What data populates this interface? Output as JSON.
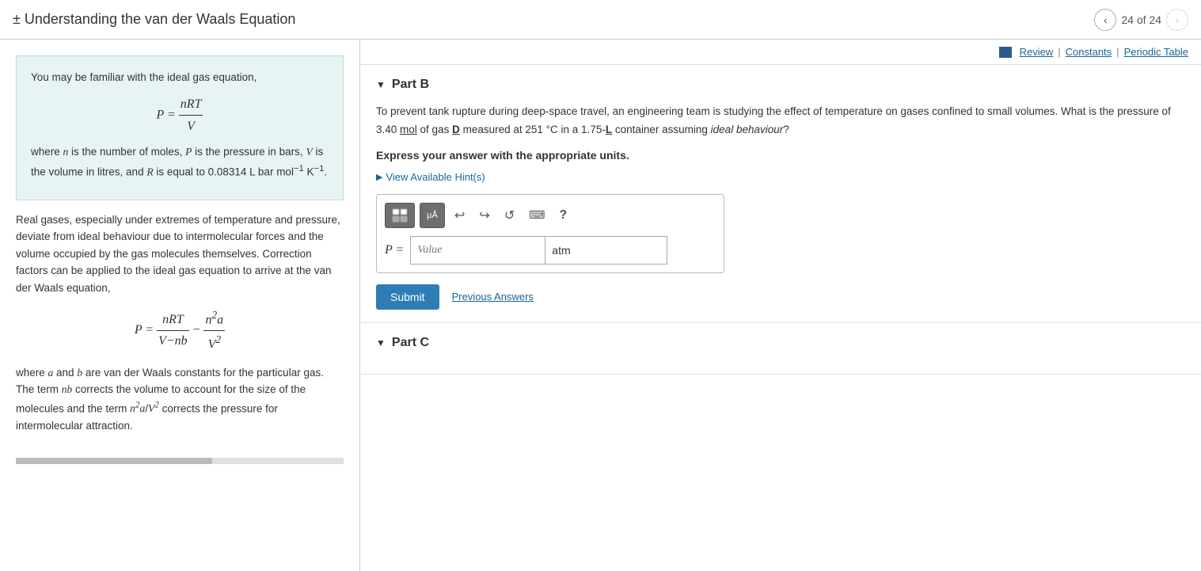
{
  "header": {
    "title": "± Understanding the van der Waals Equation",
    "pagination": "24 of 24",
    "prev_btn": "‹",
    "next_btn": "›"
  },
  "topbar": {
    "review_label": "Review",
    "constants_label": "Constants",
    "periodic_table_label": "Periodic Table",
    "sep": "|"
  },
  "left_panel": {
    "intro": "You may be familiar with the ideal gas equation,",
    "formula1_display": "P = nRT/V",
    "description1": "where n is the number of moles, P is the pressure in bars, V is the volume in litres, and R is equal to 0.08314 L bar mol⁻¹ K⁻¹.",
    "description2": "Real gases, especially under extremes of temperature and pressure, deviate from ideal behaviour due to intermolecular forces and the volume occupied by the gas molecules themselves. Correction factors can be applied to the ideal gas equation to arrive at the van der Waals equation,",
    "formula2_display": "P = nRT/(V−nb) − n²a/V²",
    "description3": "where a and b are van der Waals constants for the particular gas. The term nb corrects the volume to account for the size of the molecules and the term n²a/V² corrects the pressure for intermolecular attraction."
  },
  "part_b": {
    "label": "Part B",
    "question": "To prevent tank rupture during deep-space travel, an engineering team is studying the effect of temperature on gases confined to small volumes. What is the pressure of 3.40 mol of gas D measured at 251 °C in a 1.75-L container assuming ideal behaviour?",
    "bold_note": "Express your answer with the appropriate units.",
    "hint_label": "View Available Hint(s)",
    "value_placeholder": "Value",
    "unit_value": "atm",
    "submit_label": "Submit",
    "prev_answers_label": "Previous Answers",
    "p_label": "P ="
  },
  "part_c": {
    "label": "Part C"
  },
  "toolbar": {
    "btn1_label": "⊞",
    "btn2_label": "μÅ",
    "undo_label": "↩",
    "redo_label": "↪",
    "reset_label": "↺",
    "keyboard_label": "⌨",
    "help_label": "?"
  }
}
